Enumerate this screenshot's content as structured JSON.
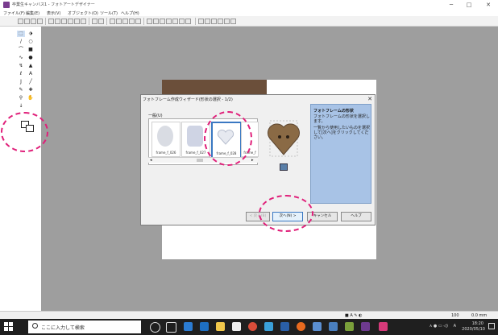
{
  "window": {
    "title": "卒業生キャンバス1 - フォトアートデザイナー",
    "minimize": "─",
    "maximize": "□",
    "close": "✕"
  },
  "menu": [
    "ファイル(F)",
    "編集(E)",
    "表示(V)",
    "オブジェクト(O)",
    "ツール(T)",
    "ヘルプ(H)"
  ],
  "dialog": {
    "title": "フォトフレーム作成ウィザード(形状の選択 - 1/2)",
    "close": "✕",
    "group_label": "一般(U)",
    "items": [
      {
        "name": "frame_f_026"
      },
      {
        "name": "frame_f_027"
      },
      {
        "name": "frame_f_028"
      },
      {
        "name": "frame_f"
      }
    ],
    "help_title": "フォトフレームの形状",
    "help_text": "フォトフレームの形状を選択します。",
    "help_text2": "一覧から使用したいものを選択して[次へ]をクリックしてください。",
    "buttons": {
      "back": "< 戻る(B)",
      "next": "次へ(N) >",
      "cancel": "キャンセル",
      "help": "ヘルプ"
    }
  },
  "statusbar": {
    "zoom": "100",
    "coords": "0.0 mm"
  },
  "taskbar": {
    "search_placeholder": "ここに入力して検索",
    "time": "18:20",
    "date": "2020/05/10",
    "lang": "A"
  },
  "colors": {
    "workspace": "#9e9e9e",
    "help_panel": "#a8c3e6",
    "annotation": "#e0207a",
    "selected_border": "#3a78c2"
  }
}
